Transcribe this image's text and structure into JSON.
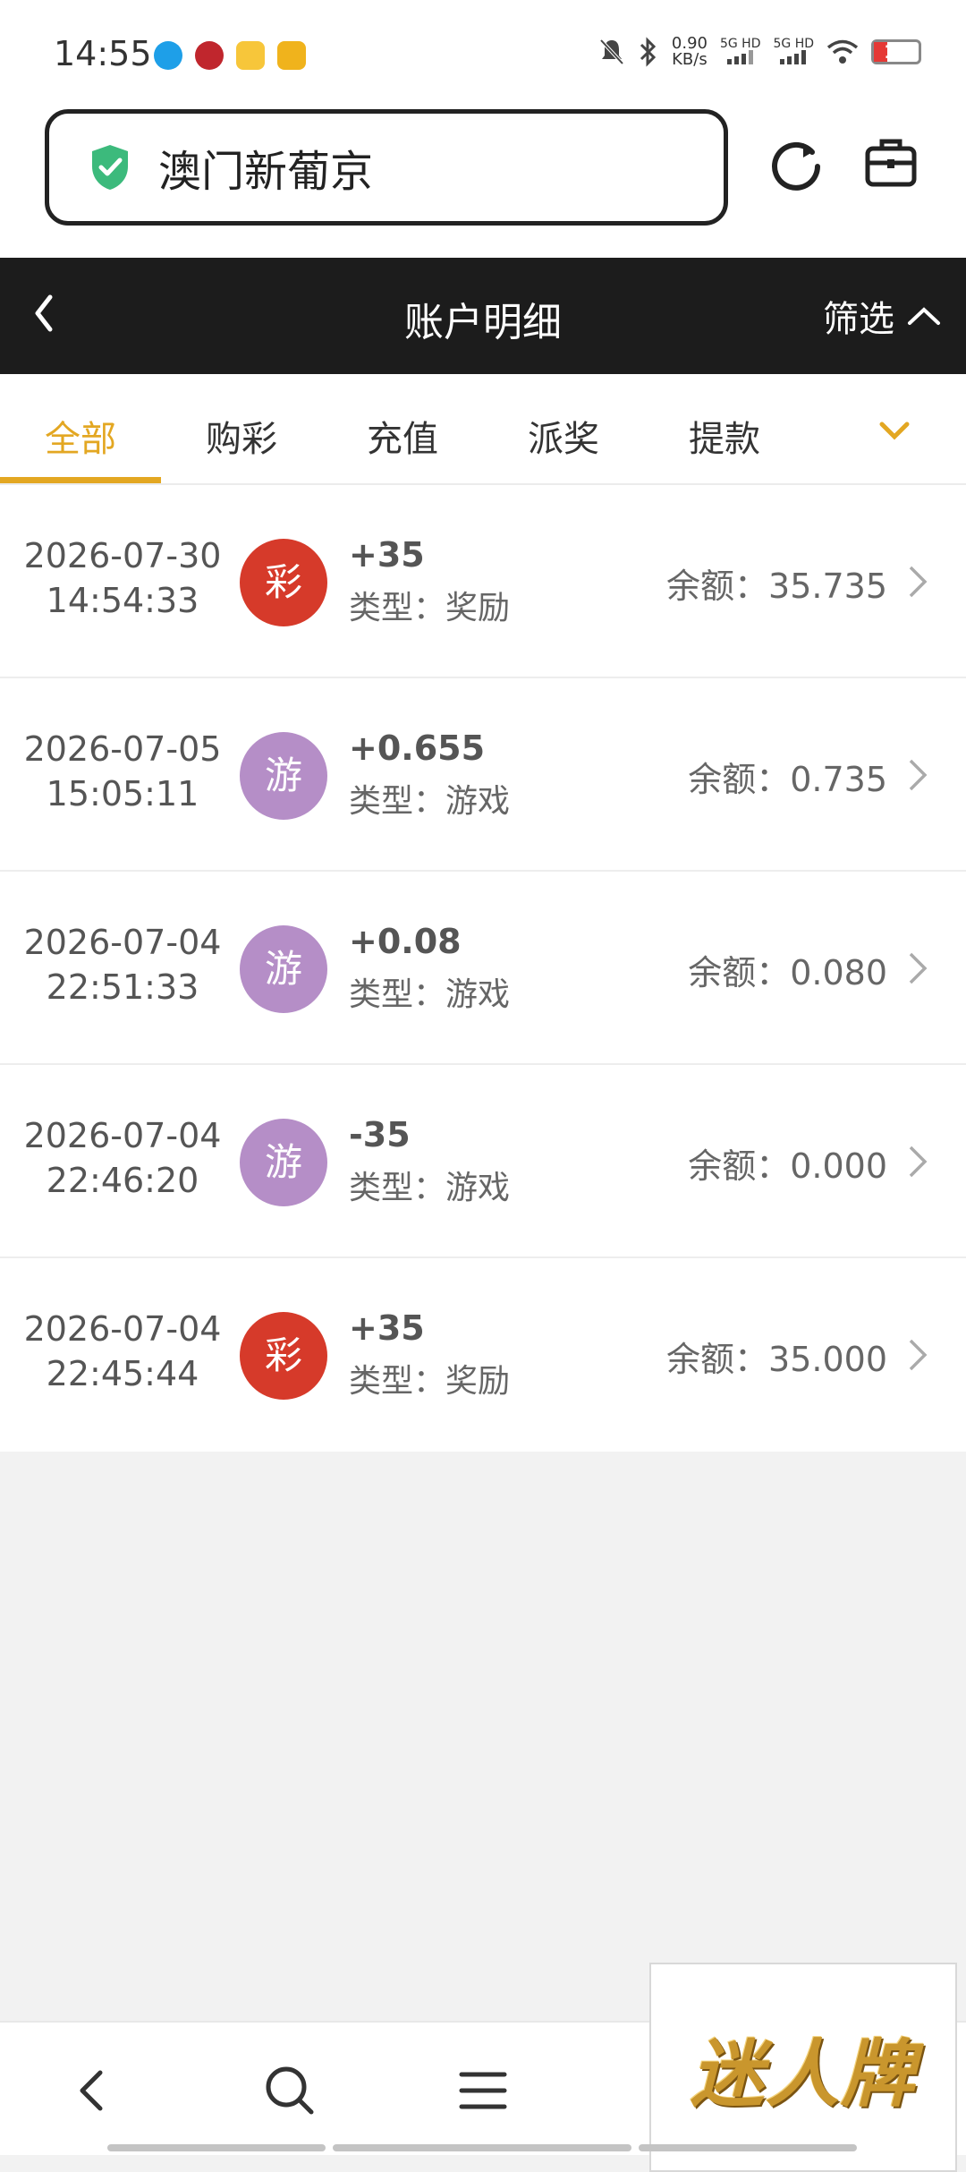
{
  "status_bar": {
    "time": "14:55",
    "net_speed_value": "0.90",
    "net_speed_unit": "KB/s",
    "signal1": "5G HD",
    "signal2": "5G HD",
    "battery": "15"
  },
  "browser": {
    "url_title": "澳门新葡京",
    "secure_icon": "shield-check-icon",
    "reload_icon": "reload-icon",
    "tools_icon": "toolbox-icon"
  },
  "header": {
    "title": "账户明细",
    "filter_label": "筛选"
  },
  "tabs": [
    {
      "label": "全部",
      "active": true
    },
    {
      "label": "购彩",
      "active": false
    },
    {
      "label": "充值",
      "active": false
    },
    {
      "label": "派奖",
      "active": false
    },
    {
      "label": "提款",
      "active": false
    }
  ],
  "records": [
    {
      "date": "2026-07-30",
      "time": "14:54:33",
      "badge": "彩",
      "badge_color": "#d63a2a",
      "amount": "+35",
      "type": "类型：奖励",
      "balance": "余额：35.735"
    },
    {
      "date": "2026-07-05",
      "time": "15:05:11",
      "badge": "游",
      "badge_color": "#b58ec7",
      "amount": "+0.655",
      "type": "类型：游戏",
      "balance": "余额：0.735"
    },
    {
      "date": "2026-07-04",
      "time": "22:51:33",
      "badge": "游",
      "badge_color": "#b58ec7",
      "amount": "+0.08",
      "type": "类型：游戏",
      "balance": "余额：0.080"
    },
    {
      "date": "2026-07-04",
      "time": "22:46:20",
      "badge": "游",
      "badge_color": "#b58ec7",
      "amount": "-35",
      "type": "类型：游戏",
      "balance": "余额：0.000"
    },
    {
      "date": "2026-07-04",
      "time": "22:45:44",
      "badge": "彩",
      "badge_color": "#d63a2a",
      "amount": "+35",
      "type": "类型：奖励",
      "balance": "余额：35.000"
    }
  ],
  "ad": {
    "text": "迷人牌"
  },
  "colors": {
    "accent": "#e3a722",
    "header_bg": "#1c1c1c",
    "lottery_badge": "#d63a2a",
    "game_badge": "#b58ec7"
  }
}
